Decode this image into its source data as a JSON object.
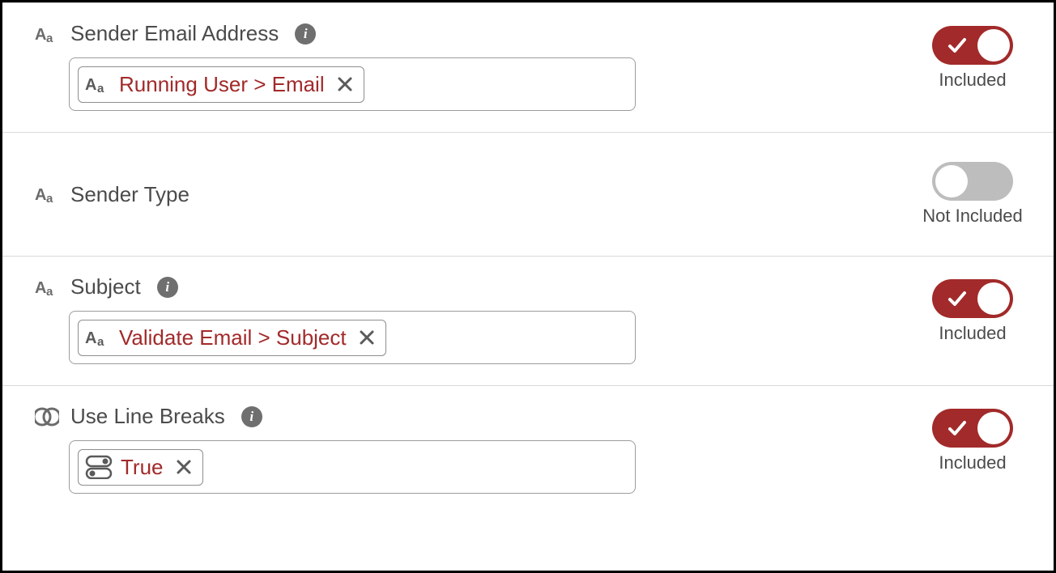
{
  "toggleCaptions": {
    "on": "Included",
    "off": "Not Included"
  },
  "fields": [
    {
      "key": "sender_email",
      "type": "text",
      "label": "Sender Email Address",
      "info": true,
      "included": true,
      "pill": {
        "text": "Running User > Email",
        "pillType": "text"
      }
    },
    {
      "key": "sender_type",
      "type": "text",
      "label": "Sender Type",
      "info": false,
      "included": false,
      "pill": null
    },
    {
      "key": "subject",
      "type": "text",
      "label": "Subject",
      "info": true,
      "included": true,
      "pill": {
        "text": "Validate Email > Subject",
        "pillType": "text"
      }
    },
    {
      "key": "use_line_breaks",
      "type": "boolean",
      "label": "Use Line Breaks",
      "info": true,
      "included": true,
      "pill": {
        "text": "True",
        "pillType": "boolean"
      }
    }
  ]
}
